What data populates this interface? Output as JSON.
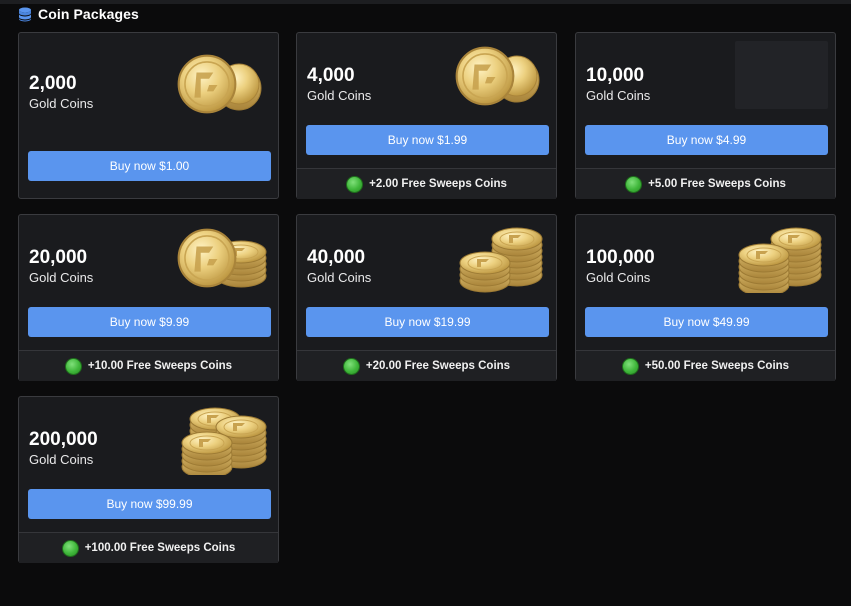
{
  "header": {
    "title": "Coin Packages",
    "icon": "database-icon"
  },
  "packages": [
    {
      "amount": "2,000",
      "unit": "Gold Coins",
      "buy_label": "Buy now $1.00",
      "bonus": "",
      "art": "coins-small-icon"
    },
    {
      "amount": "4,000",
      "unit": "Gold Coins",
      "buy_label": "Buy now $1.99",
      "bonus": "+2.00 Free Sweeps Coins",
      "art": "coins-small-icon"
    },
    {
      "amount": "10,000",
      "unit": "Gold Coins",
      "buy_label": "Buy now $4.99",
      "bonus": "+5.00 Free Sweeps Coins",
      "art": "image-placeholder"
    },
    {
      "amount": "20,000",
      "unit": "Gold Coins",
      "buy_label": "Buy now $9.99",
      "bonus": "+10.00 Free Sweeps Coins",
      "art": "coins-stack-icon"
    },
    {
      "amount": "40,000",
      "unit": "Gold Coins",
      "buy_label": "Buy now $19.99",
      "bonus": "+20.00 Free Sweeps Coins",
      "art": "coins-double-stack-icon"
    },
    {
      "amount": "100,000",
      "unit": "Gold Coins",
      "buy_label": "Buy now $49.99",
      "bonus": "+50.00 Free Sweeps Coins",
      "art": "coins-double-stack-icon"
    },
    {
      "amount": "200,000",
      "unit": "Gold Coins",
      "buy_label": "Buy now $99.99",
      "bonus": "+100.00 Free Sweeps Coins",
      "art": "coins-pile-icon"
    }
  ],
  "colors": {
    "button": "#5a95ee",
    "card": "#1a1b1e",
    "background": "#0b0b0c",
    "sweeps": "#3fb63a",
    "coin": "#e2c06a"
  }
}
